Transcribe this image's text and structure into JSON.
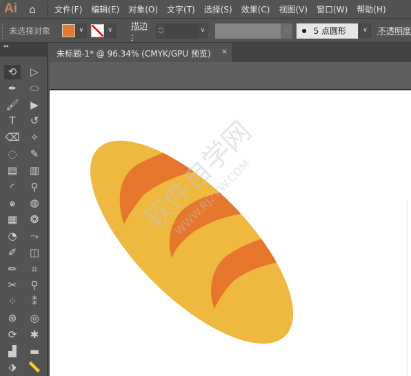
{
  "app": {
    "logo": "Ai",
    "home_icon": "home-icon"
  },
  "menu": [
    "文件(F)",
    "编辑(E)",
    "对象(O)",
    "文字(T)",
    "选择(S)",
    "效果(C)",
    "视图(V)",
    "窗口(W)",
    "帮助(H)"
  ],
  "control": {
    "selection": "未选择对象",
    "fill_color": "#E67A2C",
    "stroke_label": "描边",
    "stroke_sep": ":",
    "brush_dot": "●",
    "brush_label": "5 点圆形",
    "opacity_label": "不透明度"
  },
  "panel": {
    "collapse": "◂◂"
  },
  "document": {
    "tab_title": "未标题-1* @ 96.34% (CMYK/GPU 预览)",
    "close": "×"
  },
  "artwork": {
    "bread_color": "#EFB83E",
    "stripe_color": "#E5762B",
    "watermark_cn": "软件自学网",
    "watermark_url": "WWW.RJZXW.COM"
  },
  "tools": [
    [
      "lasso-select-icon",
      "direct-selection-icon"
    ],
    [
      "pen-icon",
      "ellipse-icon"
    ],
    [
      "paintbrush-icon",
      "selection-arrow-icon"
    ],
    [
      "type-icon",
      "rotate-icon"
    ],
    [
      "eraser-icon",
      "magic-wand-icon"
    ],
    [
      "lasso-icon",
      "pencil-icon"
    ],
    [
      "gradient-icon",
      "column-graph-icon"
    ],
    [
      "arc-icon",
      "eyedropper-icon"
    ],
    [
      "spiral-icon",
      "blob-icon"
    ],
    [
      "rectangular-grid-icon",
      "polar-grid-icon"
    ],
    [
      "shaper-icon",
      "puppet-warp-icon"
    ],
    [
      "blob-brush-icon",
      "shape-builder-icon"
    ],
    [
      "crayon-icon",
      "artboard-icon"
    ],
    [
      "scissors-icon",
      "zoom-icon"
    ],
    [
      "symbol-sprayer-icon",
      "symbol-shifter-icon"
    ],
    [
      "symbol-scruncher-icon",
      "symbol-sizer-icon"
    ],
    [
      "symbol-spinner-icon",
      "symbol-stainer-icon"
    ],
    [
      "perspective-grid-icon",
      "slice-icon"
    ],
    [
      "live-paint-selection-icon",
      "measure-icon"
    ]
  ]
}
